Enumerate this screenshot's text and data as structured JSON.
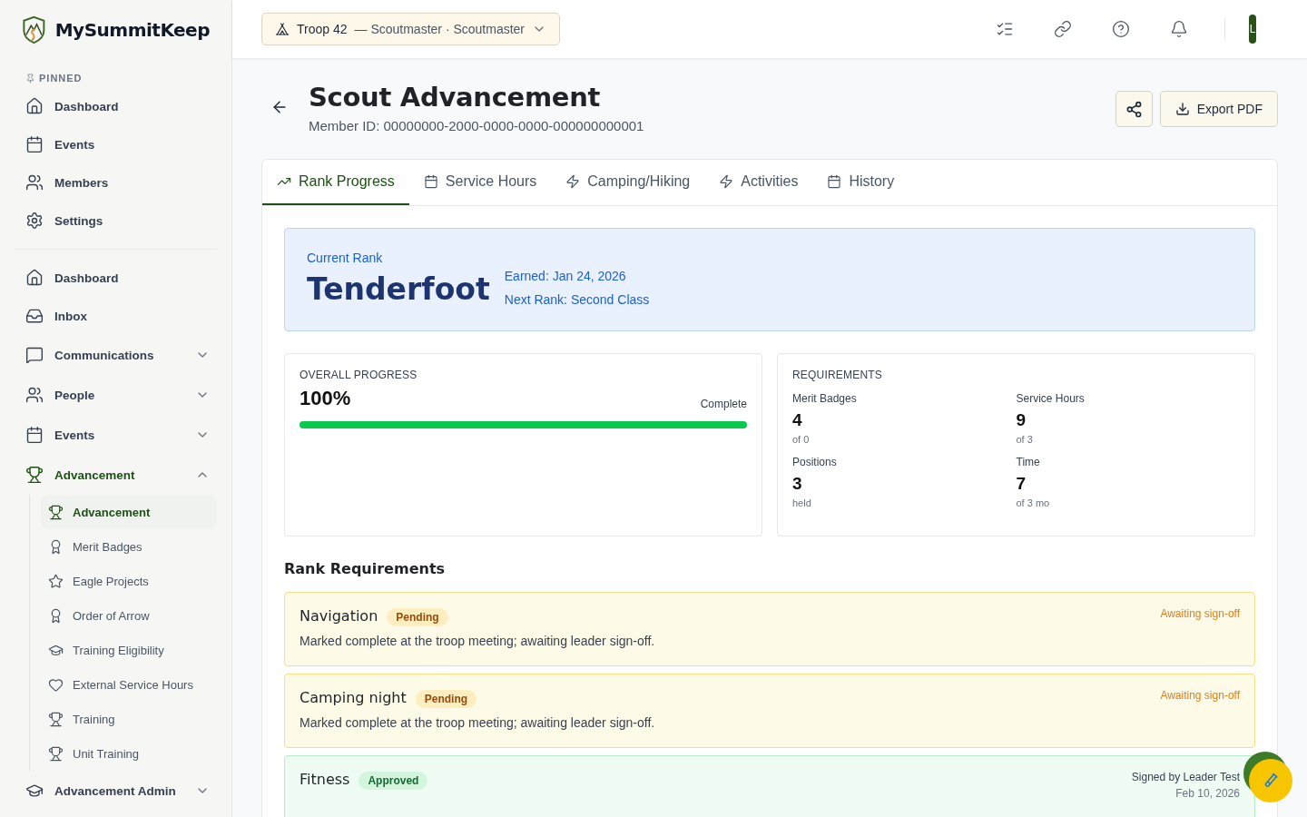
{
  "app": {
    "name": "MySummitKeep"
  },
  "sidebar": {
    "pinned": {
      "label": "PINNED",
      "items": [
        {
          "label": "Dashboard"
        },
        {
          "label": "Events"
        },
        {
          "label": "Members"
        },
        {
          "label": "Settings"
        }
      ]
    },
    "nav": [
      {
        "label": "Dashboard",
        "kind": "link"
      },
      {
        "label": "Inbox",
        "kind": "link"
      },
      {
        "label": "Communications",
        "kind": "group",
        "expanded": false
      },
      {
        "label": "People",
        "kind": "group",
        "expanded": false
      },
      {
        "label": "Events",
        "kind": "group",
        "expanded": false
      },
      {
        "label": "Advancement",
        "kind": "group",
        "expanded": true,
        "children": [
          {
            "label": "Advancement",
            "selected": true
          },
          {
            "label": "Merit Badges",
            "selected": false
          },
          {
            "label": "Eagle Projects",
            "selected": false
          },
          {
            "label": "Order of Arrow",
            "selected": false
          },
          {
            "label": "Training Eligibility",
            "selected": false
          },
          {
            "label": "External Service Hours",
            "selected": false
          },
          {
            "label": "Training",
            "selected": false
          },
          {
            "label": "Unit Training",
            "selected": false
          }
        ]
      },
      {
        "label": "Advancement Admin",
        "kind": "group",
        "expanded": false
      }
    ]
  },
  "topbar": {
    "unit": "Troop 42",
    "role": "— Scoutmaster · Scoutmaster",
    "avatar": "L"
  },
  "header": {
    "title": "Scout Advancement",
    "subtitle": "Member ID: 00000000-2000-0000-0000-000000000001",
    "export": "Export PDF"
  },
  "tabs": [
    {
      "label": "Rank Progress",
      "selected": true
    },
    {
      "label": "Service Hours",
      "selected": false
    },
    {
      "label": "Camping/Hiking",
      "selected": false
    },
    {
      "label": "Activities",
      "selected": false
    },
    {
      "label": "History",
      "selected": false
    }
  ],
  "current_rank": {
    "label": "Current Rank",
    "rank": "Tenderfoot",
    "earned": "Earned: Jan 24, 2026",
    "next": "Next Rank: Second Class"
  },
  "overall_progress": {
    "label": "OVERALL PROGRESS",
    "value": "100%",
    "status": "Complete",
    "level": 1
  },
  "requirements_summary": {
    "label": "REQUIREMENTS",
    "items": [
      {
        "label": "Merit Badges",
        "value": "4",
        "note": "of 0"
      },
      {
        "label": "Service Hours",
        "value": "9",
        "note": "of 3"
      },
      {
        "label": "Positions",
        "value": "3",
        "note": "held"
      },
      {
        "label": "Time",
        "value": "7",
        "note": "of 3 mo"
      }
    ]
  },
  "rank_requirements": {
    "title": "Rank Requirements",
    "items": [
      {
        "name": "Navigation",
        "kind": "pending",
        "badge": "Pending",
        "description": "Marked complete at the troop meeting; awaiting leader sign-off.",
        "meta": [
          "Awaiting sign-off"
        ]
      },
      {
        "name": "Camping night",
        "kind": "pending",
        "badge": "Pending",
        "description": "Marked complete at the troop meeting; awaiting leader sign-off.",
        "meta": [
          "Awaiting sign-off"
        ]
      },
      {
        "name": "Fitness",
        "kind": "approved",
        "badge": "Approved",
        "meta": [
          "Signed by Leader Test",
          "Feb 10, 2026"
        ]
      }
    ]
  }
}
